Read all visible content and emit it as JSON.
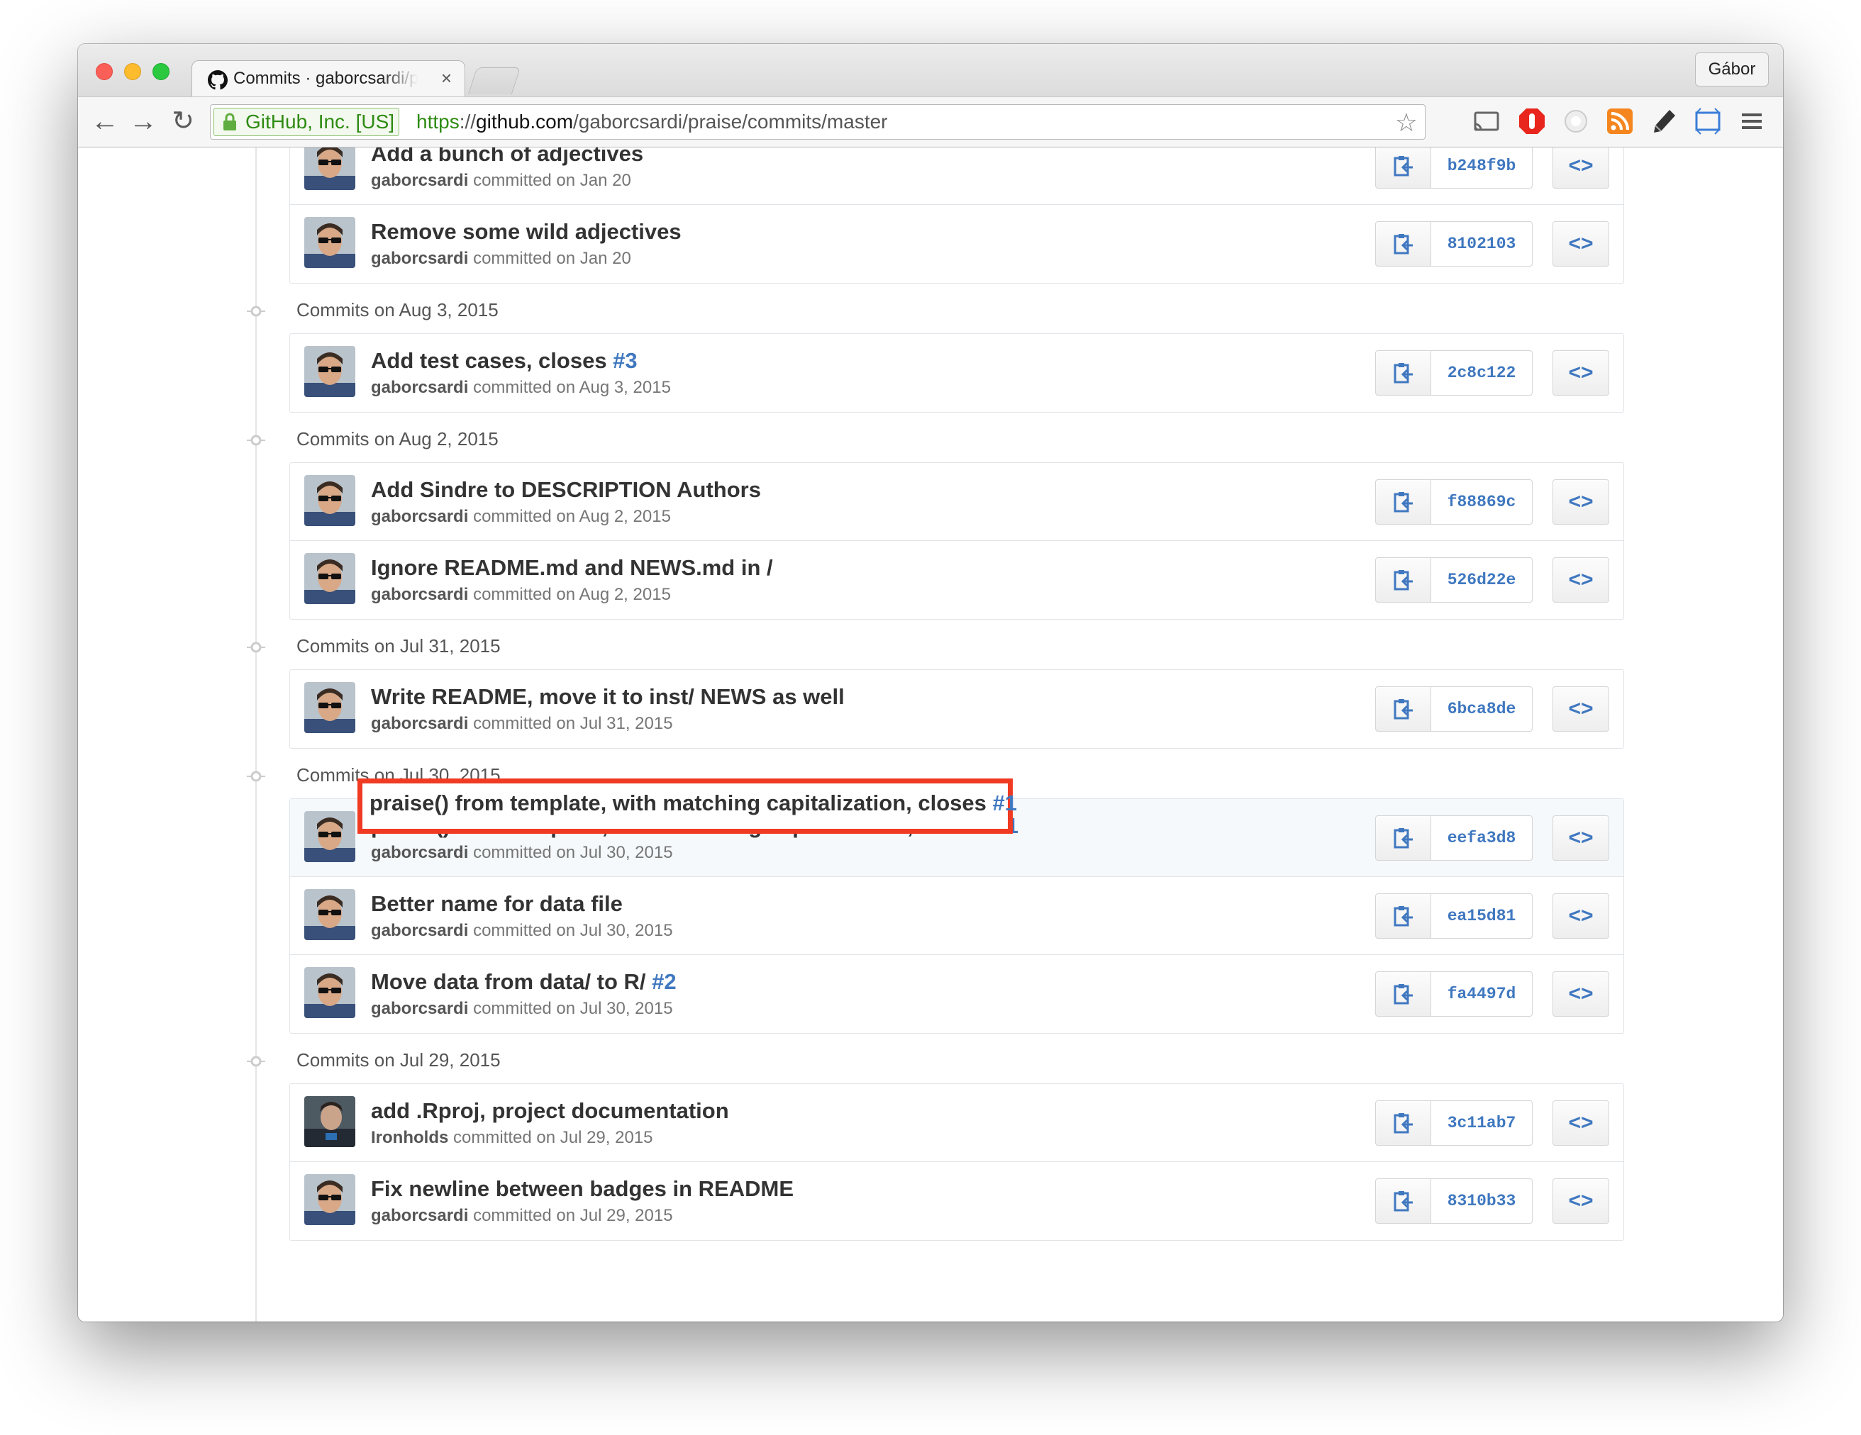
{
  "browser": {
    "tab_title": "Commits · gaborcsardi/praise",
    "tab_close": "×",
    "profile_name": "Gábor",
    "ev_label": "GitHub, Inc. [US]",
    "url_scheme": "https",
    "url_separator": "://",
    "url_host": "github.com",
    "url_path": "/gaborcsardi/praise/commits/master",
    "back_glyph": "←",
    "forward_glyph": "→",
    "reload_glyph": "↻",
    "star_glyph": "☆",
    "colors": {
      "ev_green": "#2e8b12",
      "link_blue": "#4078c0",
      "highlight_red": "#f03a22"
    }
  },
  "groups": [
    {
      "date": "",
      "commits": [
        {
          "title": "Add a bunch of adjectives",
          "issue": "",
          "author": "gaborcsardi",
          "committed": "committed on Jan 20",
          "sha": "b248f9b",
          "avatar": "gaborcsardi-avatar"
        },
        {
          "title": "Remove some wild adjectives",
          "issue": "",
          "author": "gaborcsardi",
          "committed": "committed on Jan 20",
          "sha": "8102103",
          "avatar": "gaborcsardi-avatar"
        }
      ]
    },
    {
      "date": "Commits on Aug 3, 2015",
      "commits": [
        {
          "title": "Add test cases, closes ",
          "issue": "#3",
          "author": "gaborcsardi",
          "committed": "committed on Aug 3, 2015",
          "sha": "2c8c122",
          "avatar": "gaborcsardi-avatar"
        }
      ]
    },
    {
      "date": "Commits on Aug 2, 2015",
      "commits": [
        {
          "title": "Add Sindre to DESCRIPTION Authors",
          "issue": "",
          "author": "gaborcsardi",
          "committed": "committed on Aug 2, 2015",
          "sha": "f88869c",
          "avatar": "gaborcsardi-avatar"
        },
        {
          "title": "Ignore README.md and NEWS.md in /",
          "issue": "",
          "author": "gaborcsardi",
          "committed": "committed on Aug 2, 2015",
          "sha": "526d22e",
          "avatar": "gaborcsardi-avatar"
        }
      ]
    },
    {
      "date": "Commits on Jul 31, 2015",
      "commits": [
        {
          "title": "Write README, move it to inst/ NEWS as well",
          "issue": "",
          "author": "gaborcsardi",
          "committed": "committed on Jul 31, 2015",
          "sha": "6bca8de",
          "avatar": "gaborcsardi-avatar"
        }
      ]
    },
    {
      "date": "Commits on Jul 30, 2015",
      "commits": [
        {
          "title": "praise() from template, with matching capitalization, closes ",
          "issue": "#1",
          "author": "gaborcsardi",
          "committed": "committed on Jul 30, 2015",
          "sha": "eefa3d8",
          "avatar": "gaborcsardi-avatar",
          "highlighted": true
        },
        {
          "title": "Better name for data file",
          "issue": "",
          "author": "gaborcsardi",
          "committed": "committed on Jul 30, 2015",
          "sha": "ea15d81",
          "avatar": "gaborcsardi-avatar"
        },
        {
          "title": "Move data from data/ to R/ ",
          "issue": "#2",
          "author": "gaborcsardi",
          "committed": "committed on Jul 30, 2015",
          "sha": "fa4497d",
          "avatar": "gaborcsardi-avatar"
        }
      ]
    },
    {
      "date": "Commits on Jul 29, 2015",
      "commits": [
        {
          "title": "add .Rproj, project documentation",
          "issue": "",
          "author": "Ironholds",
          "committed": "committed on Jul 29, 2015",
          "sha": "3c11ab7",
          "avatar": "ironholds-avatar"
        },
        {
          "title": "Fix newline between badges in README",
          "issue": "",
          "author": "gaborcsardi",
          "committed": "committed on Jul 29, 2015",
          "sha": "8310b33",
          "avatar": "gaborcsardi-avatar"
        }
      ]
    }
  ],
  "browse_label": "<>",
  "highlight": {
    "title": "praise() from template, with matching capitalization, closes ",
    "issue": "#1"
  }
}
